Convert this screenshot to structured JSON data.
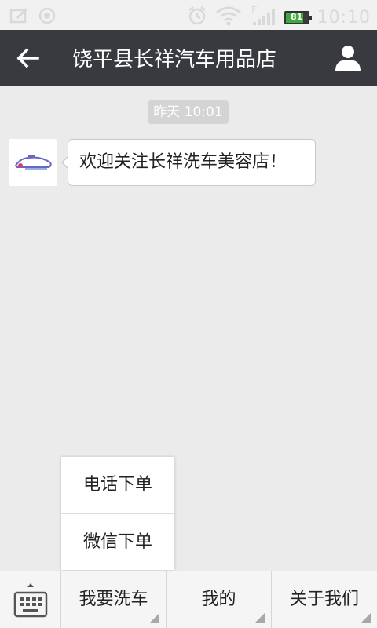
{
  "status_bar": {
    "time": "10:10",
    "battery_level": "81",
    "network_type": "E"
  },
  "header": {
    "title": "饶平县长祥汽车用品店"
  },
  "chat": {
    "timestamp": "昨天 10:01",
    "messages": [
      {
        "text": "欢迎关注长祥洗车美容店！"
      }
    ]
  },
  "popup_menu": {
    "items": [
      "电话下单",
      "微信下单"
    ]
  },
  "bottom_menu": {
    "buttons": [
      "我要洗车",
      "我的",
      "关于我们"
    ]
  },
  "colors": {
    "title_bar": "#393a3f",
    "background": "#ebebeb",
    "battery_fill": "#3ea83e"
  }
}
